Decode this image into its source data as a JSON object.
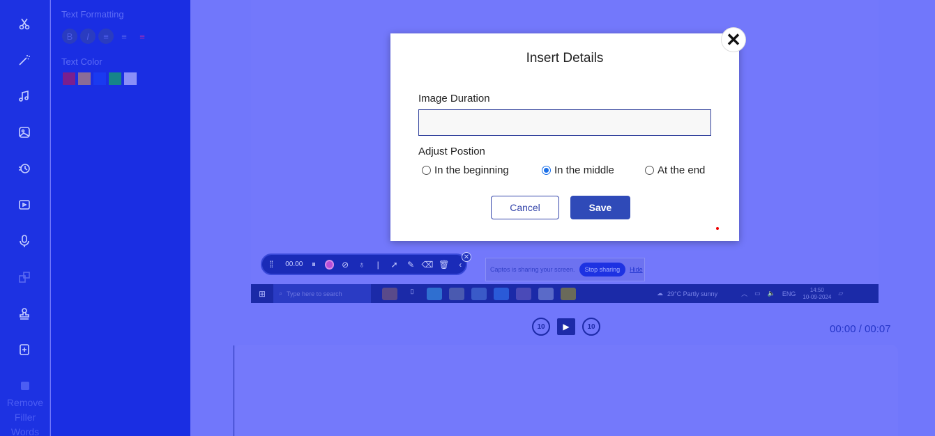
{
  "sidebar": {
    "icons": [
      "scissors-icon",
      "magic-wand-icon",
      "music-icon",
      "image-icon",
      "speed-icon",
      "video-icon",
      "microphone-icon",
      "translate-icon",
      "stamp-icon",
      "export-icon"
    ],
    "filler": {
      "lines": [
        "Remove",
        "Filler",
        "Words"
      ]
    }
  },
  "panel": {
    "text_formatting_title": "Text Formatting",
    "format_buttons": [
      "B",
      "I",
      "≡",
      "≡",
      "≡"
    ],
    "text_color_title": "Text Color",
    "swatches": [
      "#7a1f8f",
      "#8a6c97",
      "#1a3af0",
      "#16848a",
      "#8a8ff8"
    ]
  },
  "float_toolbar": {
    "timer": "00.00"
  },
  "share_banner": {
    "message": "Captos is sharing your screen.",
    "stop_label": "Stop sharing",
    "hide_label": "Hide"
  },
  "taskbar": {
    "search_placeholder": "Type here to search",
    "weather": "29°C  Partly sunny",
    "lang": "ENG",
    "time": "14:50",
    "date": "10-09-2024"
  },
  "player": {
    "rewind_label": "10",
    "forward_label": "10",
    "time_display": "00:00 / 00:07"
  },
  "modal": {
    "title": "Insert Details",
    "duration_label": "Image Duration",
    "duration_value": "",
    "position_label": "Adjust Postion",
    "options": [
      {
        "label": "In the beginning",
        "selected": false
      },
      {
        "label": "In the middle",
        "selected": true
      },
      {
        "label": "At the end",
        "selected": false
      }
    ],
    "cancel_label": "Cancel",
    "save_label": "Save",
    "close_glyph": "✕"
  }
}
